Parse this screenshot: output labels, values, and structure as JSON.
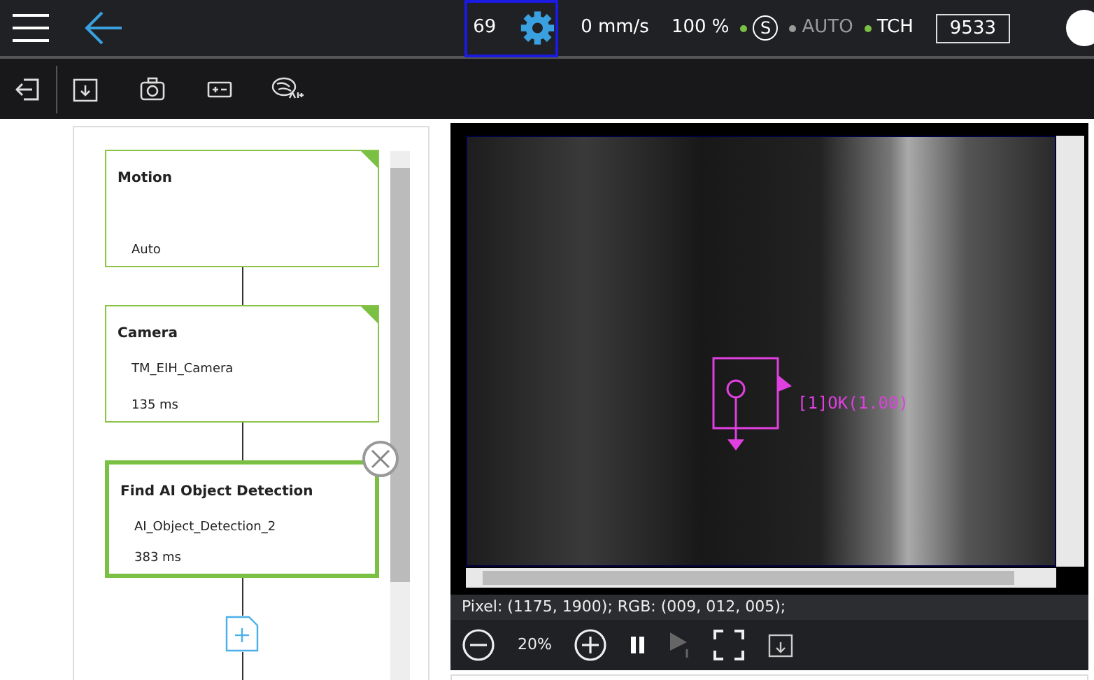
{
  "top_bar": {
    "counter": "69",
    "speed": "0 mm/s",
    "percent": "100 %",
    "indicators": [
      {
        "kind": "circled",
        "label": "S",
        "color": "#7ac143"
      },
      {
        "kind": "plain",
        "label": "AUTO",
        "color": "#9a9a9a"
      },
      {
        "kind": "plain",
        "label": "TCH",
        "color": "#7ac143"
      }
    ],
    "project_number": "9533"
  },
  "flow": {
    "nodes": [
      {
        "title": "Motion",
        "lines": [
          "Auto"
        ],
        "selected": false,
        "flagged": true
      },
      {
        "title": "Camera",
        "lines": [
          "TM_EIH_Camera",
          "135 ms"
        ],
        "selected": false,
        "flagged": true
      },
      {
        "title": "Find AI Object Detection",
        "lines": [
          "AI_Object_Detection_2",
          "383 ms"
        ],
        "selected": true,
        "flagged": false
      }
    ]
  },
  "camera": {
    "detection_label": "[1]OK(1.00)",
    "pixel_info": "Pixel: (1175, 1900); RGB: (009, 012, 005);",
    "zoom": "20%"
  }
}
